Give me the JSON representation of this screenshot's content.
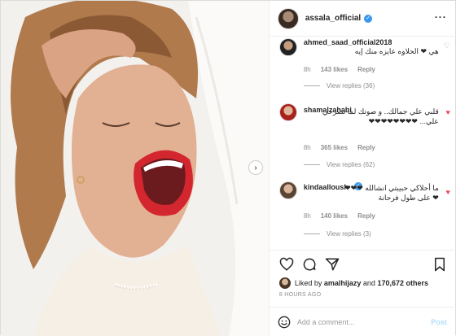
{
  "post": {
    "username": "assala_official",
    "menu_icon": "more-options-icon"
  },
  "comments": [
    {
      "username": "ahmed_saad_official2018",
      "text": "هي ❤ الحلاوه عايزه منك إيه",
      "time": "8h",
      "likes": "143 likes",
      "reply": "Reply",
      "view_replies": "View replies (36)",
      "liked": false
    },
    {
      "username": "shamalzahabi",
      "text": "قلبي علي جمالك.. و صوتك لما تصرخي علي... ❤❤❤❤❤❤❤❤",
      "time": "8h",
      "likes": "365 likes",
      "reply": "Reply",
      "view_replies": "View replies (62)",
      "liked": true
    },
    {
      "username": "kindaalloush",
      "text": "ما أحلاكي حبيبتي انشالله ❤❤❤❤ على طول فرحانة",
      "time": "8h",
      "likes": "140 likes",
      "reply": "Reply",
      "view_replies": "View replies (3)",
      "liked": true
    }
  ],
  "likes": {
    "prefix": "Liked by",
    "user": "amalhijazy",
    "conj": "and",
    "count": "170,672 others"
  },
  "timestamp": "8 HOURS AGO",
  "add_comment": {
    "placeholder": "Add a comment...",
    "post_label": "Post"
  }
}
